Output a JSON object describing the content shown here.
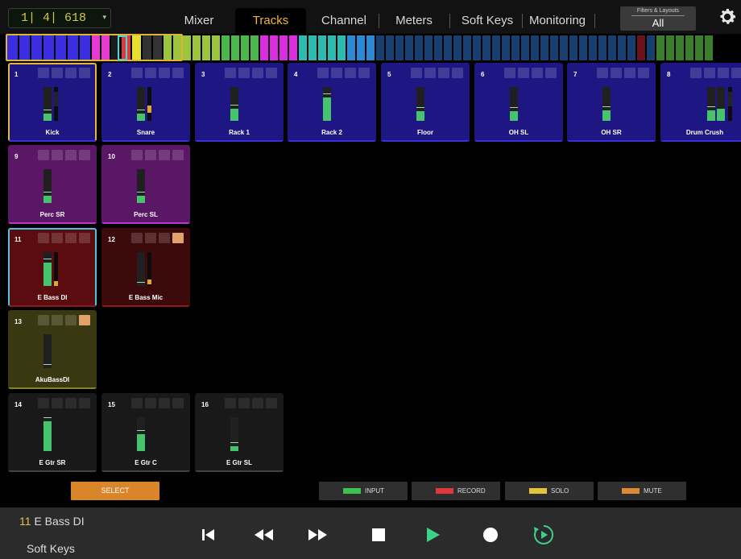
{
  "counter": {
    "value": "1| 4| 618",
    "caret": "▾"
  },
  "tabs": [
    "Mixer",
    "Tracks",
    "Channel",
    "Meters",
    "Soft Keys",
    "Monitoring"
  ],
  "active_tab": "Tracks",
  "filters": {
    "title": "Filters & Layouts",
    "value": "All"
  },
  "tracks": [
    {
      "num": "1",
      "name": "Kick",
      "bg": "#1e1683",
      "selected_color": "#e6b63a",
      "fader_level": 0.22,
      "meter": 0.85
    },
    {
      "num": "2",
      "name": "Snare",
      "bg": "#1e1683",
      "fader_level": 0.22,
      "meter": 0.45,
      "meter_color": "#e1a62c"
    },
    {
      "num": "3",
      "name": "Rack 1",
      "bg": "#1e1683",
      "fader_level": 0.35
    },
    {
      "num": "4",
      "name": "Rack 2",
      "bg": "#1e1683",
      "fader_level": 0.68
    },
    {
      "num": "5",
      "name": "Floor",
      "bg": "#1e1683",
      "fader_level": 0.28
    },
    {
      "num": "6",
      "name": "OH SL",
      "bg": "#1e1683",
      "fader_level": 0.28
    },
    {
      "num": "7",
      "name": "OH SR",
      "bg": "#1e1683",
      "fader_level": 0.32
    },
    {
      "num": "8",
      "name": "Drum Crush",
      "bg": "#1e1683",
      "fader_level": 0.3,
      "meter": 0.85,
      "extra_fader": true
    },
    {
      "num": "9",
      "name": "Perc SR",
      "bg": "#5a1766",
      "fader_level": 0.22
    },
    {
      "num": "10",
      "name": "Perc SL",
      "bg": "#5a1766",
      "fader_level": 0.22
    },
    {
      "num": "11",
      "name": "E Bass DI",
      "bg": "#5a0c0e",
      "selected_color": "#4cc3e3",
      "fader_level": 0.68,
      "meter": 0.15
    },
    {
      "num": "12",
      "name": "E Bass Mic",
      "bg": "#3d0a0b",
      "fader_level": 0.0,
      "meter": 0.2,
      "mute_on": true
    },
    {
      "num": "13",
      "name": "AkuBassDI",
      "bg": "#3a3810",
      "fader_level": 0.0,
      "mute_on": true
    },
    {
      "num": "14",
      "name": "E Gtr SR",
      "bg": "#191919",
      "fader_level": 0.88
    },
    {
      "num": "15",
      "name": "E Gtr C",
      "bg": "#191919",
      "fader_level": 0.5
    },
    {
      "num": "16",
      "name": "E Gtr SL",
      "bg": "#191919",
      "fader_level": 0.15
    }
  ],
  "select_button": "SELECT",
  "legend": [
    {
      "label": "INPUT",
      "color": "#3fc050"
    },
    {
      "label": "RECORD",
      "color": "#e0393c"
    },
    {
      "label": "SOLO",
      "color": "#e2c33a"
    },
    {
      "label": "MUTE",
      "color": "#dd8a33"
    }
  ],
  "transport": {
    "track_number": "11",
    "track_name": "E Bass DI",
    "soft_keys_label": "Soft Keys",
    "buttons": [
      "go-to-start",
      "rewind",
      "fast-forward",
      "stop",
      "play",
      "record",
      "cycle"
    ]
  },
  "colors": {
    "accent": "#f0b63c",
    "play": "#3fd08a"
  }
}
